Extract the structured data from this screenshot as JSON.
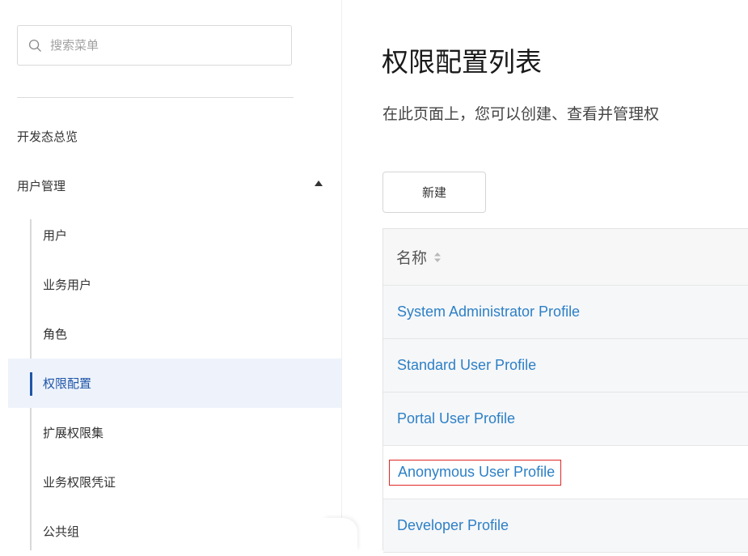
{
  "sidebar": {
    "search_placeholder": "搜索菜单",
    "nav_overview": "开发态总览",
    "nav_user_management": "用户管理",
    "sub_items": [
      "用户",
      "业务用户",
      "角色",
      "权限配置",
      "扩展权限集",
      "业务权限凭证",
      "公共组"
    ],
    "active_item": "权限配置"
  },
  "main": {
    "title": "权限配置列表",
    "description": "在此页面上，您可以创建、查看并管理权",
    "new_button": "新建",
    "table": {
      "header_name": "名称",
      "rows": [
        "System Administrator Profile",
        "Standard User Profile",
        "Portal User Profile",
        "Anonymous User Profile",
        "Developer Profile"
      ],
      "highlighted_row": "Anonymous User Profile"
    }
  },
  "colors": {
    "link": "#2d80c6",
    "active_text": "#1f55a8",
    "active_bg": "#eef3fb",
    "highlight_border": "#e02727"
  }
}
